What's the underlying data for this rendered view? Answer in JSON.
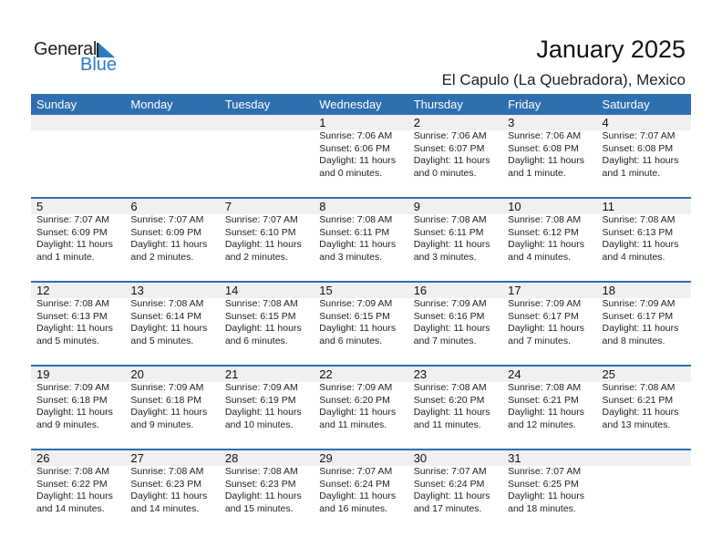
{
  "logo": {
    "word1": "General",
    "word2": "Blue",
    "icon": "triangle-flag-icon",
    "accent_color": "#2a7cc7"
  },
  "header": {
    "title": "January 2025",
    "location": "El Capulo (La Quebradora), Mexico"
  },
  "theme": {
    "header_bg": "#2e6fb0",
    "date_band_bg": "#f0f0f0"
  },
  "weekdays": [
    "Sunday",
    "Monday",
    "Tuesday",
    "Wednesday",
    "Thursday",
    "Friday",
    "Saturday"
  ],
  "weeks": [
    [
      null,
      null,
      null,
      {
        "day": "1",
        "sunrise": "Sunrise: 7:06 AM",
        "sunset": "Sunset: 6:06 PM",
        "daylight1": "Daylight: 11 hours",
        "daylight2": "and 0 minutes."
      },
      {
        "day": "2",
        "sunrise": "Sunrise: 7:06 AM",
        "sunset": "Sunset: 6:07 PM",
        "daylight1": "Daylight: 11 hours",
        "daylight2": "and 0 minutes."
      },
      {
        "day": "3",
        "sunrise": "Sunrise: 7:06 AM",
        "sunset": "Sunset: 6:08 PM",
        "daylight1": "Daylight: 11 hours",
        "daylight2": "and 1 minute."
      },
      {
        "day": "4",
        "sunrise": "Sunrise: 7:07 AM",
        "sunset": "Sunset: 6:08 PM",
        "daylight1": "Daylight: 11 hours",
        "daylight2": "and 1 minute."
      }
    ],
    [
      {
        "day": "5",
        "sunrise": "Sunrise: 7:07 AM",
        "sunset": "Sunset: 6:09 PM",
        "daylight1": "Daylight: 11 hours",
        "daylight2": "and 1 minute."
      },
      {
        "day": "6",
        "sunrise": "Sunrise: 7:07 AM",
        "sunset": "Sunset: 6:09 PM",
        "daylight1": "Daylight: 11 hours",
        "daylight2": "and 2 minutes."
      },
      {
        "day": "7",
        "sunrise": "Sunrise: 7:07 AM",
        "sunset": "Sunset: 6:10 PM",
        "daylight1": "Daylight: 11 hours",
        "daylight2": "and 2 minutes."
      },
      {
        "day": "8",
        "sunrise": "Sunrise: 7:08 AM",
        "sunset": "Sunset: 6:11 PM",
        "daylight1": "Daylight: 11 hours",
        "daylight2": "and 3 minutes."
      },
      {
        "day": "9",
        "sunrise": "Sunrise: 7:08 AM",
        "sunset": "Sunset: 6:11 PM",
        "daylight1": "Daylight: 11 hours",
        "daylight2": "and 3 minutes."
      },
      {
        "day": "10",
        "sunrise": "Sunrise: 7:08 AM",
        "sunset": "Sunset: 6:12 PM",
        "daylight1": "Daylight: 11 hours",
        "daylight2": "and 4 minutes."
      },
      {
        "day": "11",
        "sunrise": "Sunrise: 7:08 AM",
        "sunset": "Sunset: 6:13 PM",
        "daylight1": "Daylight: 11 hours",
        "daylight2": "and 4 minutes."
      }
    ],
    [
      {
        "day": "12",
        "sunrise": "Sunrise: 7:08 AM",
        "sunset": "Sunset: 6:13 PM",
        "daylight1": "Daylight: 11 hours",
        "daylight2": "and 5 minutes."
      },
      {
        "day": "13",
        "sunrise": "Sunrise: 7:08 AM",
        "sunset": "Sunset: 6:14 PM",
        "daylight1": "Daylight: 11 hours",
        "daylight2": "and 5 minutes."
      },
      {
        "day": "14",
        "sunrise": "Sunrise: 7:08 AM",
        "sunset": "Sunset: 6:15 PM",
        "daylight1": "Daylight: 11 hours",
        "daylight2": "and 6 minutes."
      },
      {
        "day": "15",
        "sunrise": "Sunrise: 7:09 AM",
        "sunset": "Sunset: 6:15 PM",
        "daylight1": "Daylight: 11 hours",
        "daylight2": "and 6 minutes."
      },
      {
        "day": "16",
        "sunrise": "Sunrise: 7:09 AM",
        "sunset": "Sunset: 6:16 PM",
        "daylight1": "Daylight: 11 hours",
        "daylight2": "and 7 minutes."
      },
      {
        "day": "17",
        "sunrise": "Sunrise: 7:09 AM",
        "sunset": "Sunset: 6:17 PM",
        "daylight1": "Daylight: 11 hours",
        "daylight2": "and 7 minutes."
      },
      {
        "day": "18",
        "sunrise": "Sunrise: 7:09 AM",
        "sunset": "Sunset: 6:17 PM",
        "daylight1": "Daylight: 11 hours",
        "daylight2": "and 8 minutes."
      }
    ],
    [
      {
        "day": "19",
        "sunrise": "Sunrise: 7:09 AM",
        "sunset": "Sunset: 6:18 PM",
        "daylight1": "Daylight: 11 hours",
        "daylight2": "and 9 minutes."
      },
      {
        "day": "20",
        "sunrise": "Sunrise: 7:09 AM",
        "sunset": "Sunset: 6:18 PM",
        "daylight1": "Daylight: 11 hours",
        "daylight2": "and 9 minutes."
      },
      {
        "day": "21",
        "sunrise": "Sunrise: 7:09 AM",
        "sunset": "Sunset: 6:19 PM",
        "daylight1": "Daylight: 11 hours",
        "daylight2": "and 10 minutes."
      },
      {
        "day": "22",
        "sunrise": "Sunrise: 7:09 AM",
        "sunset": "Sunset: 6:20 PM",
        "daylight1": "Daylight: 11 hours",
        "daylight2": "and 11 minutes."
      },
      {
        "day": "23",
        "sunrise": "Sunrise: 7:08 AM",
        "sunset": "Sunset: 6:20 PM",
        "daylight1": "Daylight: 11 hours",
        "daylight2": "and 11 minutes."
      },
      {
        "day": "24",
        "sunrise": "Sunrise: 7:08 AM",
        "sunset": "Sunset: 6:21 PM",
        "daylight1": "Daylight: 11 hours",
        "daylight2": "and 12 minutes."
      },
      {
        "day": "25",
        "sunrise": "Sunrise: 7:08 AM",
        "sunset": "Sunset: 6:21 PM",
        "daylight1": "Daylight: 11 hours",
        "daylight2": "and 13 minutes."
      }
    ],
    [
      {
        "day": "26",
        "sunrise": "Sunrise: 7:08 AM",
        "sunset": "Sunset: 6:22 PM",
        "daylight1": "Daylight: 11 hours",
        "daylight2": "and 14 minutes."
      },
      {
        "day": "27",
        "sunrise": "Sunrise: 7:08 AM",
        "sunset": "Sunset: 6:23 PM",
        "daylight1": "Daylight: 11 hours",
        "daylight2": "and 14 minutes."
      },
      {
        "day": "28",
        "sunrise": "Sunrise: 7:08 AM",
        "sunset": "Sunset: 6:23 PM",
        "daylight1": "Daylight: 11 hours",
        "daylight2": "and 15 minutes."
      },
      {
        "day": "29",
        "sunrise": "Sunrise: 7:07 AM",
        "sunset": "Sunset: 6:24 PM",
        "daylight1": "Daylight: 11 hours",
        "daylight2": "and 16 minutes."
      },
      {
        "day": "30",
        "sunrise": "Sunrise: 7:07 AM",
        "sunset": "Sunset: 6:24 PM",
        "daylight1": "Daylight: 11 hours",
        "daylight2": "and 17 minutes."
      },
      {
        "day": "31",
        "sunrise": "Sunrise: 7:07 AM",
        "sunset": "Sunset: 6:25 PM",
        "daylight1": "Daylight: 11 hours",
        "daylight2": "and 18 minutes."
      },
      null
    ]
  ]
}
